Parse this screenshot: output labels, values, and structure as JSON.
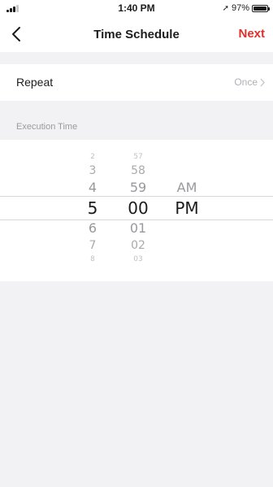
{
  "status_bar": {
    "time": "1:40 PM",
    "battery": "97%",
    "battery_level": 0.97,
    "location_icon": "location-arrow-icon"
  },
  "nav": {
    "title": "Time Schedule",
    "next_label": "Next",
    "back_icon": "chevron-left-icon",
    "accent_color": "#e0302c"
  },
  "repeat": {
    "label": "Repeat",
    "value": "Once",
    "chevron_icon": "chevron-right-icon"
  },
  "execution": {
    "header": "Execution Time"
  },
  "picker": {
    "hours": [
      "2",
      "3",
      "4",
      "5",
      "6",
      "7",
      "8"
    ],
    "minutes": [
      "57",
      "58",
      "59",
      "00",
      "01",
      "02",
      "03"
    ],
    "periods": [
      "AM",
      "PM"
    ],
    "selected_hour": "5",
    "selected_minute": "00",
    "selected_period": "PM"
  }
}
